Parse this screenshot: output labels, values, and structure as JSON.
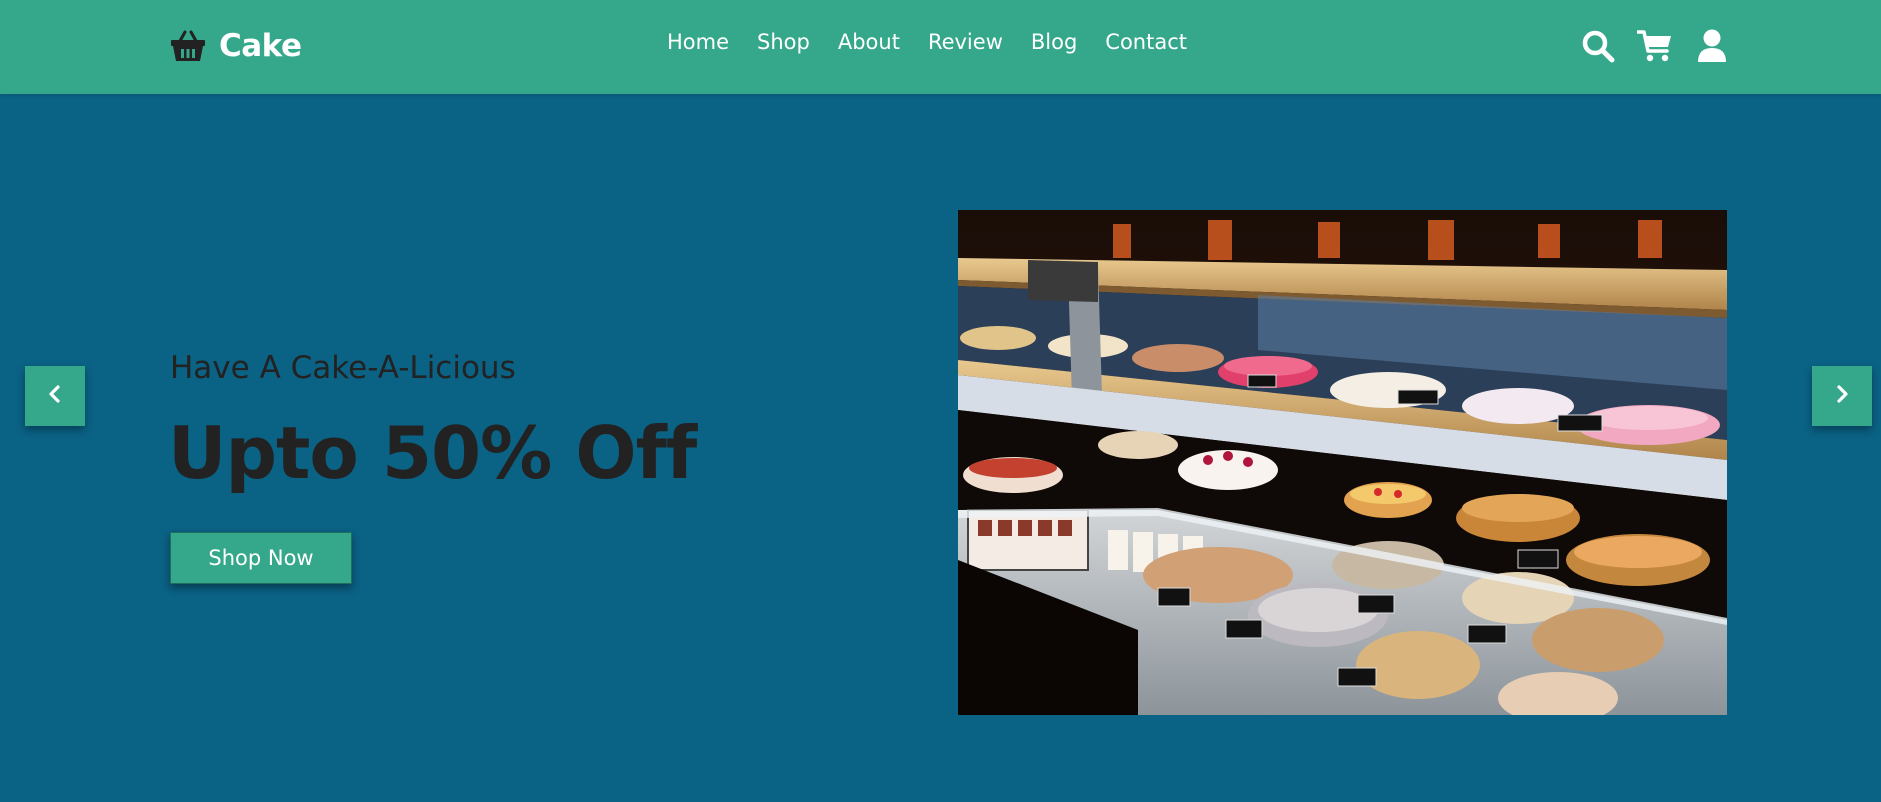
{
  "brand": {
    "name": "Cake",
    "icon": "basket-icon"
  },
  "nav": {
    "items": [
      "Home",
      "Shop",
      "About",
      "Review",
      "Blog",
      "Contact"
    ]
  },
  "header_icons": [
    "search-icon",
    "cart-icon",
    "user-icon"
  ],
  "hero": {
    "subtitle": "Have A Cake-A-Licious",
    "title": "Upto 50% Off",
    "button_label": "Shop Now",
    "image": "bakery-display-case-photo"
  },
  "slider": {
    "prev_icon": "chevron-left-icon",
    "next_icon": "chevron-right-icon"
  },
  "colors": {
    "header_bg": "#35a88b",
    "page_bg": "#0a6285",
    "text_dark": "#222222",
    "text_light": "#ffffff"
  }
}
